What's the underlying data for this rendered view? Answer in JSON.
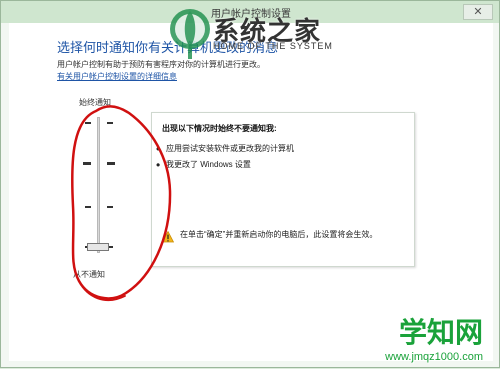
{
  "window": {
    "title": "用户帐户控制设置",
    "close_label": "✕"
  },
  "main": {
    "heading": "选择何时通知你有关计算机更改的消息",
    "description": "用户帐户控制有助于预防有害程序对你的计算机进行更改。",
    "learn_more_link": "有关用户帐户控制设置的详细信息"
  },
  "slider": {
    "top_label": "始终通知",
    "bottom_label": "从不通知",
    "level_value": 0.0,
    "levels": 4
  },
  "info_panel": {
    "title": "出现以下情况时始终不要通知我:",
    "items": [
      "应用尝试安装软件或更改我的计算机",
      "我更改了 Windows 设置"
    ],
    "warning_text": "在单击“确定”并重新启动你的电脑后，此设置将会生效。"
  },
  "watermarks": {
    "top_brand": "系统之家",
    "top_brand_sub": "HOME OF THE SYSTEM",
    "bottom_brand": "学知网",
    "bottom_url": "www.jmqz1000.com"
  },
  "colors": {
    "accent_blue": "#1f55a6",
    "annotation_red": "#d01010",
    "watermark_green": "#1aa23a"
  },
  "icons": {
    "warning": "warning-icon",
    "close": "close-icon"
  }
}
